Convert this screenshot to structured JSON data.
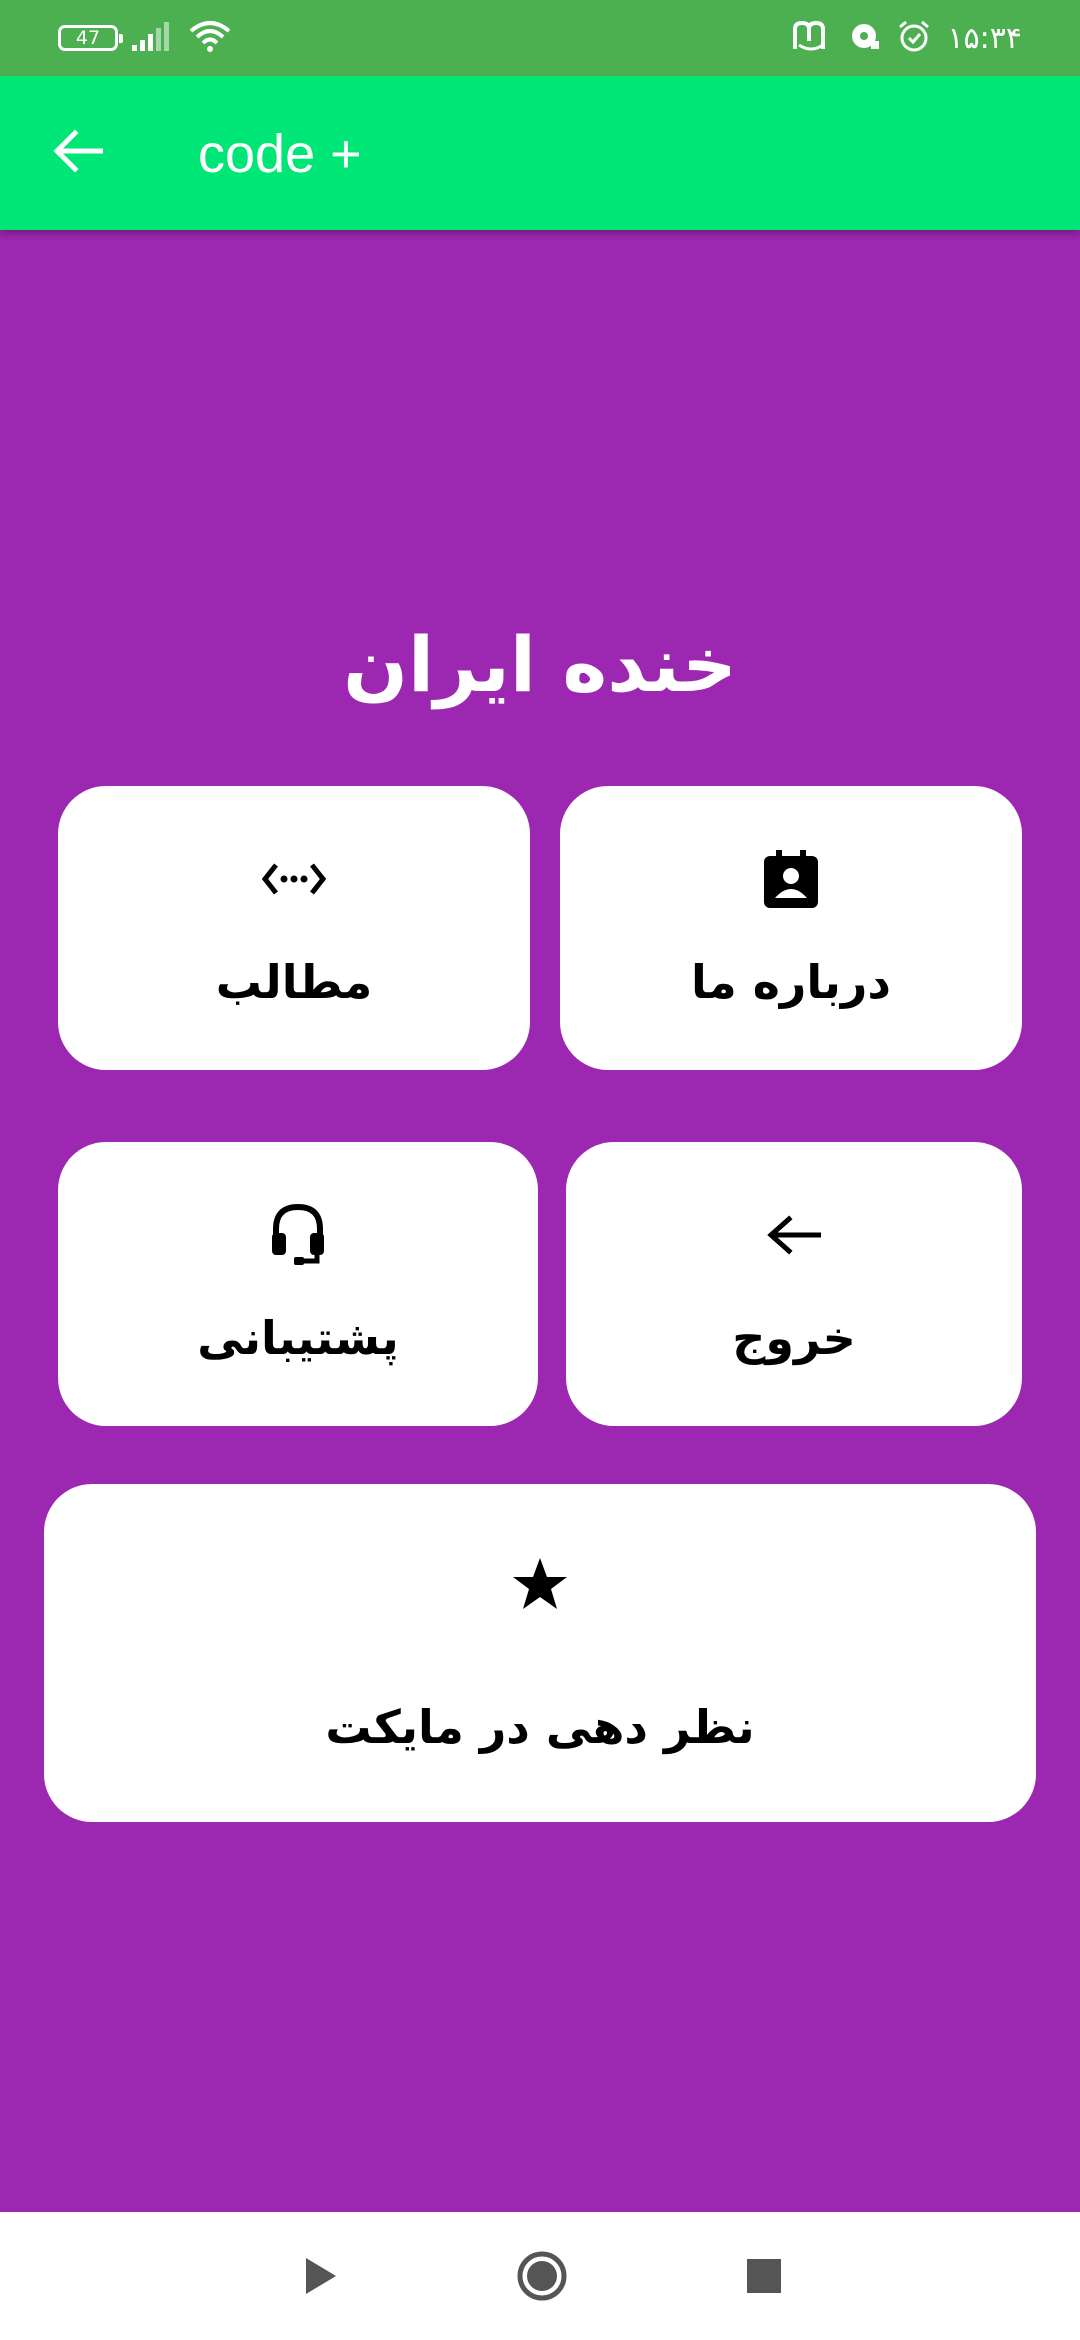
{
  "status_bar": {
    "battery": "47",
    "time": "۱۵:۳۴",
    "icons": [
      "battery-icon",
      "signal-icon",
      "wifi-icon",
      "app-m-icon",
      "media-icon",
      "alarm-icon"
    ]
  },
  "app_bar": {
    "title": "code +",
    "back_icon": "arrow-left-icon"
  },
  "brand": {
    "title": "خنده ایران"
  },
  "menu": {
    "about": {
      "label": "درباره ما",
      "icon": "contact-card-icon"
    },
    "content": {
      "label": "مطالب",
      "icon": "code-icon"
    },
    "exit": {
      "label": "خروج",
      "icon": "arrow-left-icon"
    },
    "support": {
      "label": "پشتیبانی",
      "icon": "headset-icon"
    },
    "rate": {
      "label": "نظر دهی در مایکت",
      "icon": "star-icon"
    }
  },
  "nav_bar": {
    "icons": [
      "back-triangle-icon",
      "home-circle-icon",
      "recents-square-icon"
    ]
  },
  "colors": {
    "status_bar": "#4caf50",
    "app_bar": "#00e676",
    "background": "#9c27b0",
    "card": "#ffffff"
  }
}
